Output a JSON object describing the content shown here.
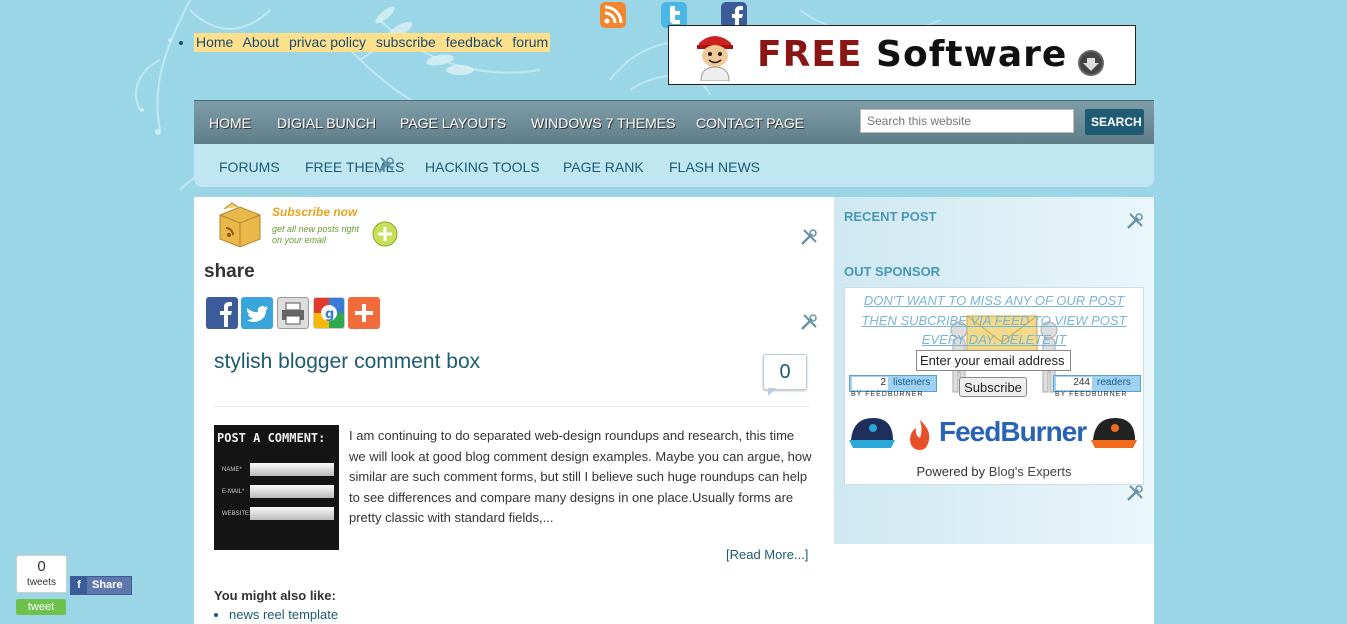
{
  "top_links": [
    "Home",
    "About",
    "privac policy",
    "subscribe",
    "feedback",
    "forum"
  ],
  "banner": {
    "word1": "FREE",
    "word2": "Software"
  },
  "nav_primary": [
    "HOME",
    "DIGIAL BUNCH",
    "PAGE LAYOUTS",
    "WINDOWS 7 THEMES",
    "CONTACT PAGE"
  ],
  "search": {
    "placeholder": "Search this website",
    "button": "SEARCH"
  },
  "nav_secondary": [
    "FORUMS",
    "FREE THEMES",
    "HACKING TOOLS",
    "PAGE RANK",
    "FLASH NEWS"
  ],
  "subscribe_widget": {
    "headline": "Subscribe now",
    "line1": "get all new posts right",
    "line2": "on your email"
  },
  "share": {
    "title": "share"
  },
  "post": {
    "title": "stylish blogger comment box",
    "comment_count": "0",
    "thumb_title": "POST A COMMENT:",
    "thumb_fields": [
      "NAME*",
      "E-MAIL*",
      "WEBSITE:"
    ],
    "excerpt": "I am continuing to do separated web-design roundups and research, this time we will look at good blog comment design examples. Maybe you can argue, how similar are such comment forms, but still I believe such huge roundups can help to see differences and compare many designs in one place.Usually forms are pretty classic with standard fields,...",
    "read_more": "[Read More...]"
  },
  "also": {
    "heading": "You might also like:",
    "items": [
      "news reel template"
    ]
  },
  "sidebar": {
    "recent_post": "RECENT POST",
    "sponsor_title": "OUT SPONSOR",
    "sponsor_text": "DON'T WANT TO MISS ANY OF OUR POST THEN SUBCRIBE VIA FEED TO VIEW POST EVERY DAY. DELETE IT",
    "email_value": "Enter your email address",
    "subscribe_button": "Subscribe",
    "listeners_count": "2",
    "listeners_label": "listeners",
    "readers_count": "244",
    "readers_label": "readers",
    "by_feedburner": "BY FEEDBURNER",
    "feedburner_logo": "FeedBurner",
    "powered_prefix": "Powered by",
    "powered_name": "Blog's Experts"
  },
  "share_widgets": {
    "tweet_count": "0",
    "tweets_label": "tweets",
    "tweet_button": "tweet",
    "fb_share": "Share"
  }
}
